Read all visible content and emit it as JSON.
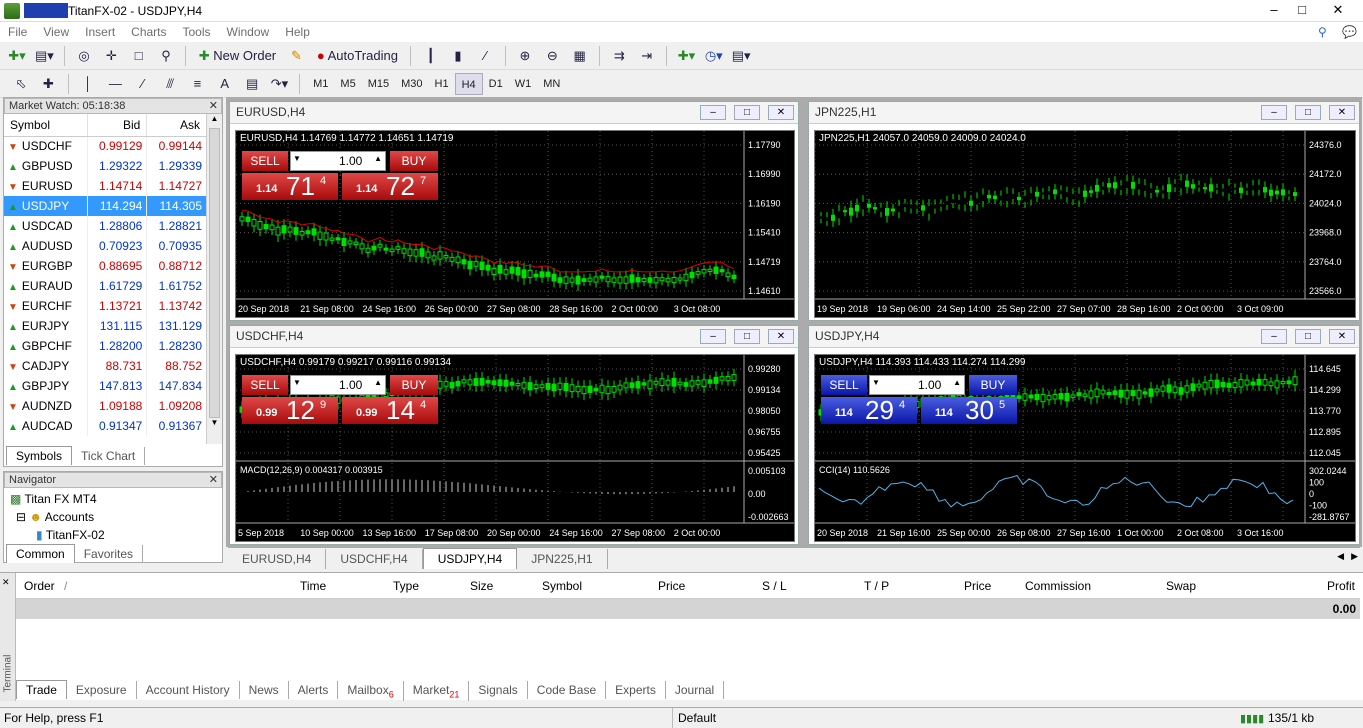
{
  "window": {
    "title": "TitanFX-02 - USDJPY,H4",
    "min": "–",
    "max": "□",
    "close": "✕"
  },
  "menu": [
    "File",
    "View",
    "Insert",
    "Charts",
    "Tools",
    "Window",
    "Help"
  ],
  "toolbar": {
    "new_order": "New Order",
    "autotrading": "AutoTrading"
  },
  "timeframes": [
    "M1",
    "M5",
    "M15",
    "M30",
    "H1",
    "H4",
    "D1",
    "W1",
    "MN"
  ],
  "selected_tf": "H4",
  "market_watch": {
    "title": "Market Watch: 05:18:38",
    "headers": {
      "symbol": "Symbol",
      "bid": "Bid",
      "ask": "Ask"
    },
    "rows": [
      {
        "symbol": "USDCHF",
        "bid": "0.99129",
        "ask": "0.99144",
        "dir": "down",
        "color": "red"
      },
      {
        "symbol": "GBPUSD",
        "bid": "1.29322",
        "ask": "1.29339",
        "dir": "up",
        "color": "blue"
      },
      {
        "symbol": "EURUSD",
        "bid": "1.14714",
        "ask": "1.14727",
        "dir": "down",
        "color": "red"
      },
      {
        "symbol": "USDJPY",
        "bid": "114.294",
        "ask": "114.305",
        "dir": "up",
        "color": "blue",
        "selected": true
      },
      {
        "symbol": "USDCAD",
        "bid": "1.28806",
        "ask": "1.28821",
        "dir": "up",
        "color": "blue"
      },
      {
        "symbol": "AUDUSD",
        "bid": "0.70923",
        "ask": "0.70935",
        "dir": "up",
        "color": "blue"
      },
      {
        "symbol": "EURGBP",
        "bid": "0.88695",
        "ask": "0.88712",
        "dir": "down",
        "color": "red"
      },
      {
        "symbol": "EURAUD",
        "bid": "1.61729",
        "ask": "1.61752",
        "dir": "up",
        "color": "blue"
      },
      {
        "symbol": "EURCHF",
        "bid": "1.13721",
        "ask": "1.13742",
        "dir": "down",
        "color": "red"
      },
      {
        "symbol": "EURJPY",
        "bid": "131.115",
        "ask": "131.129",
        "dir": "up",
        "color": "blue"
      },
      {
        "symbol": "GBPCHF",
        "bid": "1.28200",
        "ask": "1.28230",
        "dir": "up",
        "color": "blue"
      },
      {
        "symbol": "CADJPY",
        "bid": "88.731",
        "ask": "88.752",
        "dir": "down",
        "color": "red"
      },
      {
        "symbol": "GBPJPY",
        "bid": "147.813",
        "ask": "147.834",
        "dir": "up",
        "color": "blue"
      },
      {
        "symbol": "AUDNZD",
        "bid": "1.09188",
        "ask": "1.09208",
        "dir": "down",
        "color": "red"
      },
      {
        "symbol": "AUDCAD",
        "bid": "0.91347",
        "ask": "0.91367",
        "dir": "up",
        "color": "blue"
      }
    ],
    "tabs": [
      "Symbols",
      "Tick Chart"
    ]
  },
  "navigator": {
    "title": "Navigator",
    "items": [
      "Titan FX MT4",
      "Accounts",
      "TitanFX-02"
    ],
    "tabs": [
      "Common",
      "Favorites"
    ]
  },
  "charts": [
    {
      "title": "EURUSD,H4",
      "ohlc": "EURUSD,H4  1.14769 1.14772 1.14651 1.14719",
      "prices": [
        "1.17790",
        "1.16990",
        "1.16190",
        "1.15410",
        "1.14719",
        "1.14610"
      ],
      "dates": [
        "20 Sep 2018",
        "21 Sep 08:00",
        "24 Sep 16:00",
        "26 Sep 00:00",
        "27 Sep 08:00",
        "28 Sep 16:00",
        "2 Oct 00:00",
        "3 Oct 08:00"
      ],
      "sell": {
        "label": "SELL",
        "big": "71",
        "small": "1.14",
        "sup": "4"
      },
      "buy": {
        "label": "BUY",
        "big": "72",
        "small": "1.14",
        "sup": "7"
      },
      "lot": "1.00",
      "theme": "red"
    },
    {
      "title": "JPN225,H1",
      "ohlc": "JPN225,H1  24057.0 24059.0 24009.0 24024.0",
      "prices": [
        "24376.0",
        "24172.0",
        "24024.0",
        "23968.0",
        "23764.0",
        "23566.0"
      ],
      "dates": [
        "19 Sep 2018",
        "19 Sep 06:00",
        "24 Sep 14:00",
        "25 Sep 22:00",
        "27 Sep 07:00",
        "28 Sep 16:00",
        "2 Oct 00:00",
        "3 Oct 09:00"
      ]
    },
    {
      "title": "USDCHF,H4",
      "ohlc": "USDCHF,H4  0.99179 0.99217 0.99116 0.99134",
      "prices": [
        "0.99280",
        "0.99134",
        "0.98050",
        "0.96755",
        "0.95425"
      ],
      "macd": {
        "label": "MACD(12,26,9) 0.004317 0.003915",
        "levels": [
          "0.005103",
          "0.00",
          "-0.002663"
        ]
      },
      "dates": [
        "5 Sep 2018",
        "10 Sep 00:00",
        "13 Sep 16:00",
        "17 Sep 08:00",
        "20 Sep 00:00",
        "24 Sep 16:00",
        "27 Sep 08:00",
        "2 Oct 00:00"
      ],
      "sell": {
        "label": "SELL",
        "big": "12",
        "small": "0.99",
        "sup": "9"
      },
      "buy": {
        "label": "BUY",
        "big": "14",
        "small": "0.99",
        "sup": "4"
      },
      "lot": "1.00",
      "theme": "red"
    },
    {
      "title": "USDJPY,H4",
      "ohlc": "USDJPY,H4  114.393 114.433 114.274 114.299",
      "prices": [
        "114.645",
        "114.299",
        "113.770",
        "112.895",
        "112.045"
      ],
      "cci": {
        "label": "CCI(14) 110.5626",
        "levels": [
          "302.0244",
          "100",
          "0",
          "-100",
          "-281.8767"
        ]
      },
      "dates": [
        "20 Sep 2018",
        "21 Sep 16:00",
        "25 Sep 00:00",
        "26 Sep 08:00",
        "27 Sep 16:00",
        "1 Oct 00:00",
        "2 Oct 08:00",
        "3 Oct 16:00"
      ],
      "sell": {
        "label": "SELL",
        "big": "29",
        "small": "114",
        "sup": "4"
      },
      "buy": {
        "label": "BUY",
        "big": "30",
        "small": "114",
        "sup": "5"
      },
      "lot": "1.00",
      "theme": "blue"
    }
  ],
  "chart_tabs": [
    "EURUSD,H4",
    "USDCHF,H4",
    "USDJPY,H4",
    "JPN225,H1"
  ],
  "active_chart_tab": "USDJPY,H4",
  "terminal": {
    "side_label": "Terminal",
    "columns": [
      "Order",
      "/",
      "Time",
      "Type",
      "Size",
      "Symbol",
      "Price",
      "S / L",
      "T / P",
      "Price",
      "Commission",
      "Swap",
      "Profit"
    ],
    "total": "0.00",
    "tabs": [
      {
        "label": "Trade"
      },
      {
        "label": "Exposure"
      },
      {
        "label": "Account History"
      },
      {
        "label": "News"
      },
      {
        "label": "Alerts"
      },
      {
        "label": "Mailbox",
        "badge": "6"
      },
      {
        "label": "Market",
        "badge": "21"
      },
      {
        "label": "Signals"
      },
      {
        "label": "Code Base"
      },
      {
        "label": "Experts"
      },
      {
        "label": "Journal"
      }
    ]
  },
  "status": {
    "help": "For Help, press F1",
    "profile": "Default",
    "traffic": "135/1 kb"
  }
}
